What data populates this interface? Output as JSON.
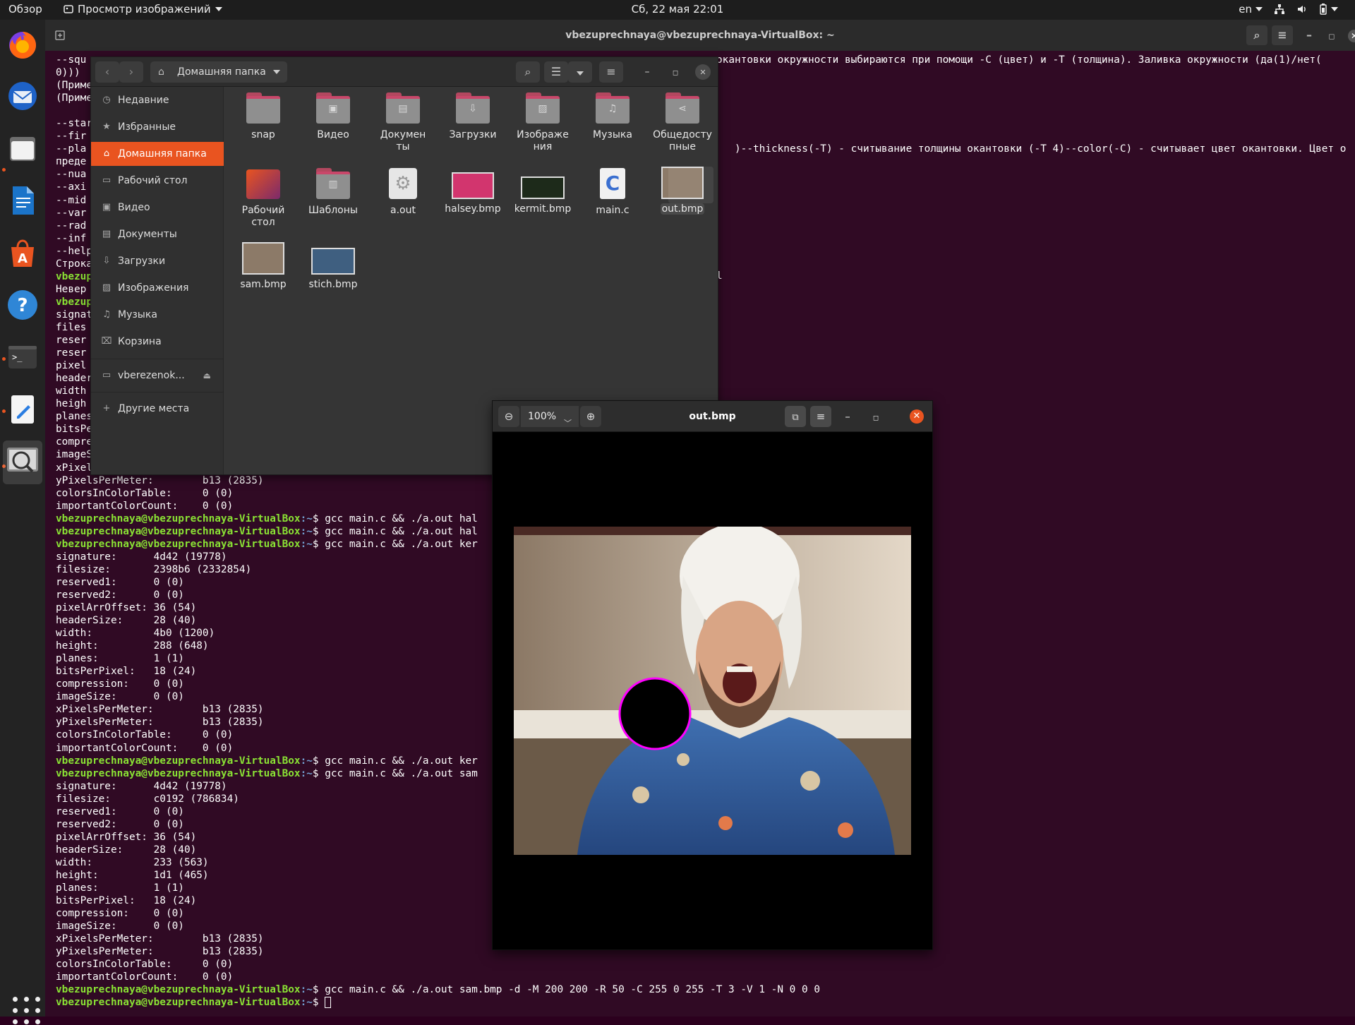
{
  "topbar": {
    "activities": "Обзор",
    "app_name": "Просмотр изображений",
    "clock": "Сб, 22 мая  22:01",
    "lang": "en"
  },
  "dock": {
    "items": [
      "firefox-icon",
      "thunderbird-icon",
      "files-icon",
      "writer-icon",
      "app-center-icon",
      "help-icon",
      "terminal-icon",
      "text-editor-icon",
      "image-viewer-icon"
    ]
  },
  "terminal": {
    "title": "vbezuprechnaya@vbezuprechnaya-VirtualBox: ~",
    "prompt_user": "vbezuprechnaya@vbezuprechnaya-VirtualBox",
    "prompt_path": ":~",
    "prompt_dollar": "$ ",
    "top_lines": [
      "--squ",
      "0))) ",
      "(Приме",
      "(Приме",
      "",
      "--star",
      "--fir",
      "--pla",
      "преде",
      "--nua",
      "--axi",
      "--mid",
      "--var",
      "--rad",
      "--inf",
      "--help",
      "Строка"
    ],
    "right_fragments": {
      "line1": "окантовки окружности выбираются при помощи -C (цвет) и -T (толщина). Заливка окружности (да(1)/нет(",
      "line8": ")--thickness(-T) - считывание толщины окантовки (-T 4)--color(-C) - считывает цвет окантовки. Цвет о",
      "line18": "l"
    },
    "left_fragments": [
      {
        "prompt": true,
        "text": ""
      },
      {
        "prompt": false,
        "text": "Невер"
      },
      {
        "prompt": true,
        "text": ""
      },
      {
        "prompt": false,
        "text": "signat"
      },
      {
        "prompt": false,
        "text": "files"
      },
      {
        "prompt": false,
        "text": "reser"
      },
      {
        "prompt": false,
        "text": "reser"
      },
      {
        "prompt": false,
        "text": "pixel"
      },
      {
        "prompt": false,
        "text": "header"
      },
      {
        "prompt": false,
        "text": "width"
      },
      {
        "prompt": false,
        "text": "heigh"
      },
      {
        "prompt": false,
        "text": "planes"
      },
      {
        "prompt": false,
        "text": "bitsPe"
      },
      {
        "prompt": false,
        "text": "compre"
      },
      {
        "prompt": false,
        "text": "imageS"
      },
      {
        "prompt": false,
        "text": "xPixel"
      }
    ],
    "lines": [
      {
        "prompt": false,
        "text": "yPixelsPerMeter:        b13 (2835)"
      },
      {
        "prompt": false,
        "text": "colorsInColorTable:     0 (0)"
      },
      {
        "prompt": false,
        "text": "importantColorCount:    0 (0)"
      },
      {
        "prompt": true,
        "text": "gcc main.c && ./a.out hal"
      },
      {
        "prompt": true,
        "text": "gcc main.c && ./a.out hal"
      },
      {
        "prompt": true,
        "text": "gcc main.c && ./a.out ker"
      },
      {
        "prompt": false,
        "text": "signature:      4d42 (19778)"
      },
      {
        "prompt": false,
        "text": "filesize:       2398b6 (2332854)"
      },
      {
        "prompt": false,
        "text": "reserved1:      0 (0)"
      },
      {
        "prompt": false,
        "text": "reserved2:      0 (0)"
      },
      {
        "prompt": false,
        "text": "pixelArrOffset: 36 (54)"
      },
      {
        "prompt": false,
        "text": "headerSize:     28 (40)"
      },
      {
        "prompt": false,
        "text": "width:          4b0 (1200)"
      },
      {
        "prompt": false,
        "text": "height:         288 (648)"
      },
      {
        "prompt": false,
        "text": "planes:         1 (1)"
      },
      {
        "prompt": false,
        "text": "bitsPerPixel:   18 (24)"
      },
      {
        "prompt": false,
        "text": "compression:    0 (0)"
      },
      {
        "prompt": false,
        "text": "imageSize:      0 (0)"
      },
      {
        "prompt": false,
        "text": "xPixelsPerMeter:        b13 (2835)"
      },
      {
        "prompt": false,
        "text": "yPixelsPerMeter:        b13 (2835)"
      },
      {
        "prompt": false,
        "text": "colorsInColorTable:     0 (0)"
      },
      {
        "prompt": false,
        "text": "importantColorCount:    0 (0)"
      },
      {
        "prompt": true,
        "text": "gcc main.c && ./a.out ker"
      },
      {
        "prompt": true,
        "text": "gcc main.c && ./a.out sam"
      },
      {
        "prompt": false,
        "text": "signature:      4d42 (19778)"
      },
      {
        "prompt": false,
        "text": "filesize:       c0192 (786834)"
      },
      {
        "prompt": false,
        "text": "reserved1:      0 (0)"
      },
      {
        "prompt": false,
        "text": "reserved2:      0 (0)"
      },
      {
        "prompt": false,
        "text": "pixelArrOffset: 36 (54)"
      },
      {
        "prompt": false,
        "text": "headerSize:     28 (40)"
      },
      {
        "prompt": false,
        "text": "width:          233 (563)"
      },
      {
        "prompt": false,
        "text": "height:         1d1 (465)"
      },
      {
        "prompt": false,
        "text": "planes:         1 (1)"
      },
      {
        "prompt": false,
        "text": "bitsPerPixel:   18 (24)"
      },
      {
        "prompt": false,
        "text": "compression:    0 (0)"
      },
      {
        "prompt": false,
        "text": "imageSize:      0 (0)"
      },
      {
        "prompt": false,
        "text": "xPixelsPerMeter:        b13 (2835)"
      },
      {
        "prompt": false,
        "text": "yPixelsPerMeter:        b13 (2835)"
      },
      {
        "prompt": false,
        "text": "colorsInColorTable:     0 (0)"
      },
      {
        "prompt": false,
        "text": "importantColorCount:    0 (0)"
      },
      {
        "prompt": true,
        "text": "gcc main.c && ./a.out sam.bmp -d -M 200 200 -R 50 -C 255 0 255 -T 3 -V 1 -N 0 0 0"
      },
      {
        "prompt": true,
        "text": "",
        "cursor": true
      }
    ]
  },
  "files": {
    "path": "Домашняя папка",
    "sidebar": [
      {
        "label": "Недавние",
        "icon": "clock-icon"
      },
      {
        "label": "Избранные",
        "icon": "star-icon"
      },
      {
        "label": "Домашняя папка",
        "icon": "home-icon",
        "selected": true
      },
      {
        "label": "Рабочий стол",
        "icon": "desktop-icon"
      },
      {
        "label": "Видео",
        "icon": "video-icon"
      },
      {
        "label": "Документы",
        "icon": "document-icon"
      },
      {
        "label": "Загрузки",
        "icon": "download-icon"
      },
      {
        "label": "Изображения",
        "icon": "image-icon"
      },
      {
        "label": "Музыка",
        "icon": "music-icon"
      },
      {
        "label": "Корзина",
        "icon": "trash-icon"
      }
    ],
    "drive": "vberezenok...",
    "other": "Другие места",
    "items": [
      {
        "name": "snap",
        "kind": "folder",
        "glyph": ""
      },
      {
        "name": "Видео",
        "kind": "folder",
        "glyph": "▣"
      },
      {
        "name": "Докумен\nты",
        "kind": "folder",
        "glyph": "▤"
      },
      {
        "name": "Загрузки",
        "kind": "folder",
        "glyph": "⇩"
      },
      {
        "name": "Изображе\nния",
        "kind": "folder",
        "glyph": "▨"
      },
      {
        "name": "Музыка",
        "kind": "folder",
        "glyph": "♫"
      },
      {
        "name": "Общедосту\nпные",
        "kind": "folder",
        "glyph": "⋖"
      },
      {
        "name": "Рабочий\nстол",
        "kind": "desktop",
        "glyph": ""
      },
      {
        "name": "Шаблоны",
        "kind": "folder",
        "glyph": "▥"
      },
      {
        "name": "a.out",
        "kind": "exec",
        "glyph": "⚙"
      },
      {
        "name": "halsey.bmp",
        "kind": "thumb",
        "glyph": ""
      },
      {
        "name": "kermit.bmp",
        "kind": "thumb",
        "glyph": ""
      },
      {
        "name": "main.c",
        "kind": "csrc",
        "glyph": "C"
      },
      {
        "name": "out.bmp",
        "kind": "thumb",
        "glyph": "",
        "selected": true
      },
      {
        "name": "sam.bmp",
        "kind": "thumb",
        "glyph": ""
      },
      {
        "name": "stich.bmp",
        "kind": "thumb",
        "glyph": ""
      }
    ]
  },
  "viewer": {
    "title": "out.bmp",
    "zoom": "100%"
  },
  "colors": {
    "accent": "#e95420",
    "terminal_bg": "#300a24",
    "prompt_user": "#8ae234",
    "prompt_path": "#729fcf",
    "circle_stroke": "#ff00ff"
  }
}
